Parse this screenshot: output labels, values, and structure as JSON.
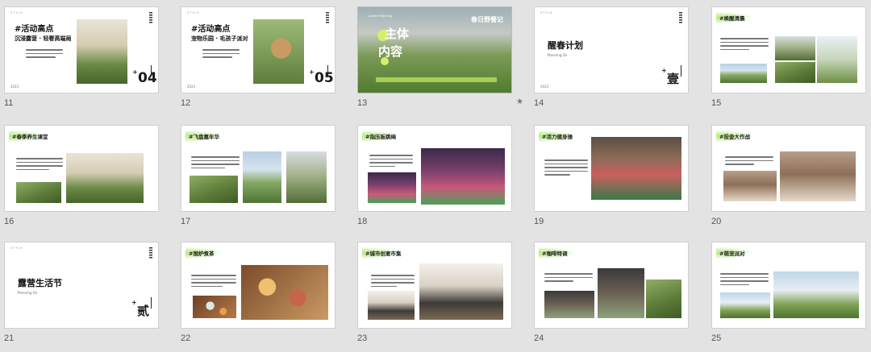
{
  "slides": [
    {
      "num": "11",
      "style": "STYLE",
      "title": "#活动高点",
      "subtitle": "沉浸露营 · 轻奢高端局",
      "big": "04",
      "year": "2023"
    },
    {
      "num": "12",
      "style": "STYLE",
      "title": "#活动高点",
      "subtitle": "宠物乐园 · 毛孩子派对",
      "big": "05",
      "year": "2023"
    },
    {
      "num": "13",
      "brand": "春日野餐记",
      "title_line1": "主体",
      "title_line2": "内容",
      "small_top": "Content Planning"
    },
    {
      "num": "14",
      "style": "STYLE",
      "title": "醒春计划",
      "subtitle": "Planning On",
      "big": "壹",
      "year": "2023"
    },
    {
      "num": "15",
      "tag": "#唤醒清晨"
    },
    {
      "num": "16",
      "tag": "#春季养生课堂"
    },
    {
      "num": "17",
      "tag": "#飞盘嘉年华"
    },
    {
      "num": "18",
      "tag": "#指压板跳绳"
    },
    {
      "num": "19",
      "tag": "#活力健身操"
    },
    {
      "num": "20",
      "tag": "#投壶大作战"
    },
    {
      "num": "21",
      "style": "STYLE",
      "title": "露营生活节",
      "subtitle": "Planning On",
      "big": "贰"
    },
    {
      "num": "22",
      "tag": "#围炉煮茶"
    },
    {
      "num": "23",
      "tag": "#城市创意市集"
    },
    {
      "num": "24",
      "tag": "#咖啡特调"
    },
    {
      "num": "25",
      "tag": "#萌宠派对"
    }
  ],
  "star_icon": "star-icon"
}
